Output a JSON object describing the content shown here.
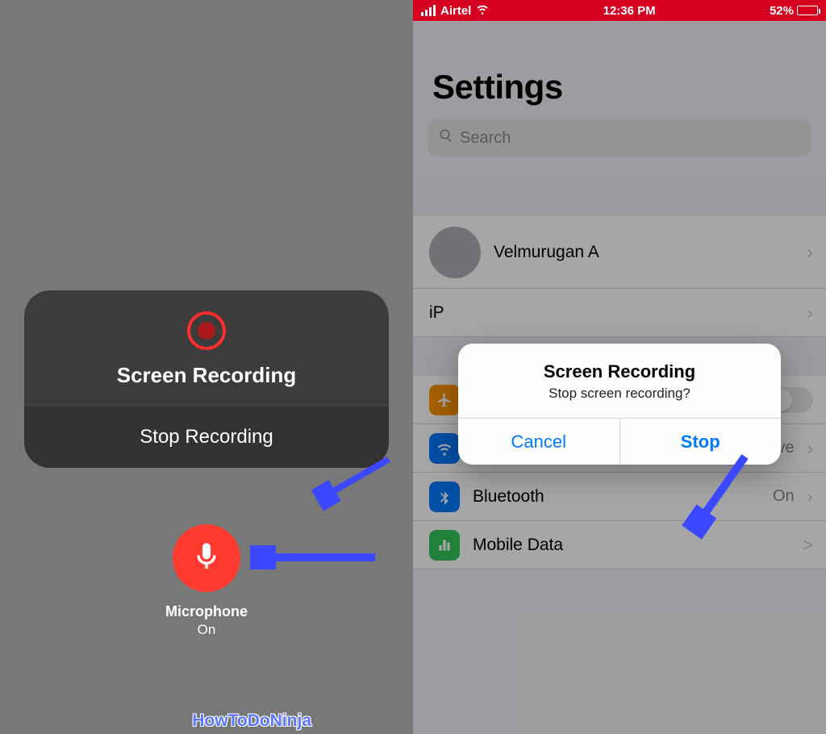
{
  "left": {
    "card_title": "Screen Recording",
    "stop_label": "Stop Recording",
    "mic_label": "Microphone",
    "mic_state": "On"
  },
  "status": {
    "carrier": "Airtel",
    "time": "12:36 PM",
    "battery_pct": "52%"
  },
  "settings": {
    "title": "Settings",
    "search_placeholder": "Search",
    "user_name": "Velmurugan A",
    "device_row": "iP",
    "rows": {
      "airplane": "Airplane Mode",
      "wifi": "Wi-Fi",
      "wifi_detail": "Mancave",
      "bluetooth": "Bluetooth",
      "bluetooth_detail": "On",
      "mobile": "Mobile Data"
    }
  },
  "alert": {
    "title": "Screen Recording",
    "message": "Stop screen recording?",
    "cancel": "Cancel",
    "stop": "Stop"
  },
  "watermark": "HowToDoNinja"
}
